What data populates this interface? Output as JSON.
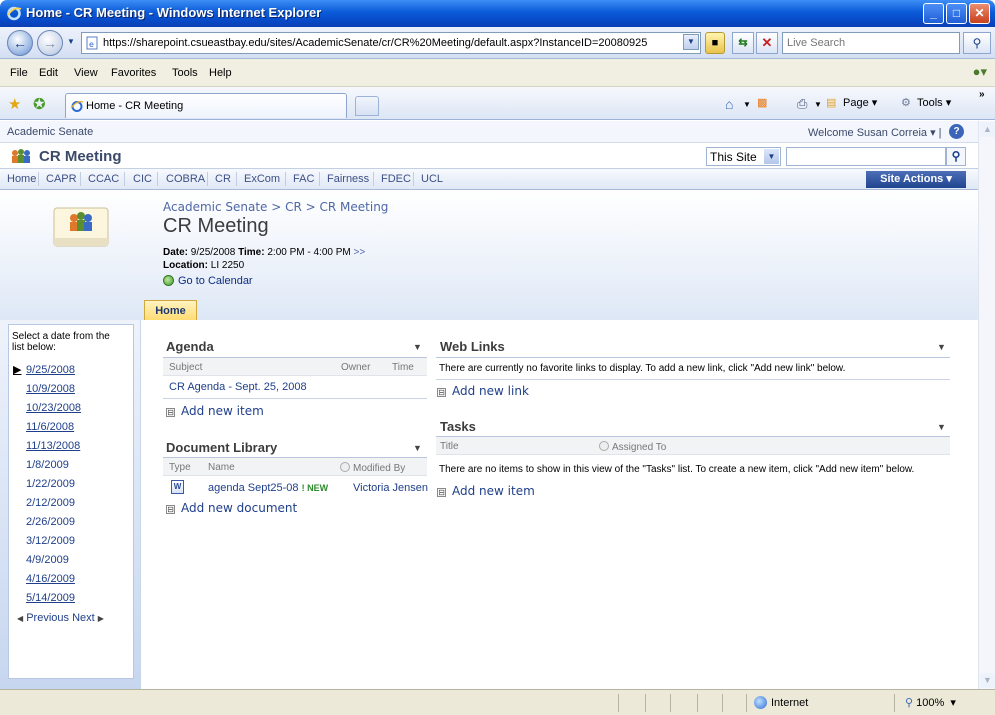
{
  "window": {
    "title": "Home - CR Meeting - Windows Internet Explorer",
    "minimize": "_",
    "maximize": "□",
    "close": "✕"
  },
  "addressbar": {
    "url": "https://sharepoint.csueastbay.edu/sites/AcademicSenate/cr/CR%20Meeting/default.aspx?InstanceID=20080925",
    "search_placeholder": "Live Search",
    "back": "←",
    "forward": "→"
  },
  "menubar": {
    "items": [
      "File",
      "Edit",
      "View",
      "Favorites",
      "Tools",
      "Help"
    ]
  },
  "tabbar": {
    "active_tab": "Home - CR Meeting",
    "commands": {
      "page": "Page",
      "tools": "Tools"
    }
  },
  "sharepoint": {
    "top_breadcrumb": "Academic Senate",
    "welcome": "Welcome Susan Correia ▾  |",
    "site_name": "CR Meeting",
    "search_scope": "This Site",
    "nav_items": [
      "Home",
      "CAPR",
      "CCAC",
      "CIC",
      "COBRA",
      "CR",
      "ExCom",
      "FAC",
      "Fairness",
      "FDEC",
      "UCL"
    ],
    "site_actions": "Site Actions ▾",
    "breadcrumb": "Academic Senate > CR > CR Meeting",
    "page_title": "CR Meeting",
    "meeting": {
      "date_label": "Date:",
      "date_value": "9/25/2008",
      "time_label": "Time:",
      "time_value": "2:00 PM - 4:00 PM",
      "more": ">>",
      "location_label": "Location:",
      "location_value": "LI 2250",
      "go_to_calendar": "Go to Calendar"
    },
    "home_tab": "Home",
    "dates_panel": {
      "hint": "Select a date from the list below:",
      "dates": [
        {
          "label": "9/25/2008",
          "linked": true,
          "current": true
        },
        {
          "label": "10/9/2008",
          "linked": true
        },
        {
          "label": "10/23/2008",
          "linked": true
        },
        {
          "label": "11/6/2008",
          "linked": true
        },
        {
          "label": "11/13/2008",
          "linked": true
        },
        {
          "label": "1/8/2009",
          "linked": false
        },
        {
          "label": "1/22/2009",
          "linked": false
        },
        {
          "label": "2/12/2009",
          "linked": false
        },
        {
          "label": "2/26/2009",
          "linked": false
        },
        {
          "label": "3/12/2009",
          "linked": false
        },
        {
          "label": "4/9/2009",
          "linked": false
        },
        {
          "label": "4/16/2009",
          "linked": true
        },
        {
          "label": "5/14/2009",
          "linked": true
        }
      ],
      "previous": "Previous",
      "next": "Next"
    },
    "agenda": {
      "title": "Agenda",
      "columns": [
        "Subject",
        "Owner",
        "Time"
      ],
      "rows": [
        {
          "subject": "CR Agenda - Sept. 25, 2008"
        }
      ],
      "add": "Add new item"
    },
    "document_library": {
      "title": "Document Library",
      "columns": [
        "Type",
        "Name",
        "Modified By"
      ],
      "rows": [
        {
          "name": "agenda Sept25-08",
          "new": "NEW",
          "modified_by": "Victoria Jensen"
        }
      ],
      "add": "Add new document"
    },
    "web_links": {
      "title": "Web Links",
      "empty": "There are currently no favorite links to display. To add a new link, click \"Add new link\" below.",
      "add": "Add new link"
    },
    "tasks": {
      "title": "Tasks",
      "columns": [
        "Title",
        "Assigned To"
      ],
      "empty": "There are no items to show in this view of the \"Tasks\" list. To create a new item, click \"Add new item\" below.",
      "add": "Add new item"
    }
  },
  "statusbar": {
    "zone": "Internet",
    "zoom": "100%"
  }
}
